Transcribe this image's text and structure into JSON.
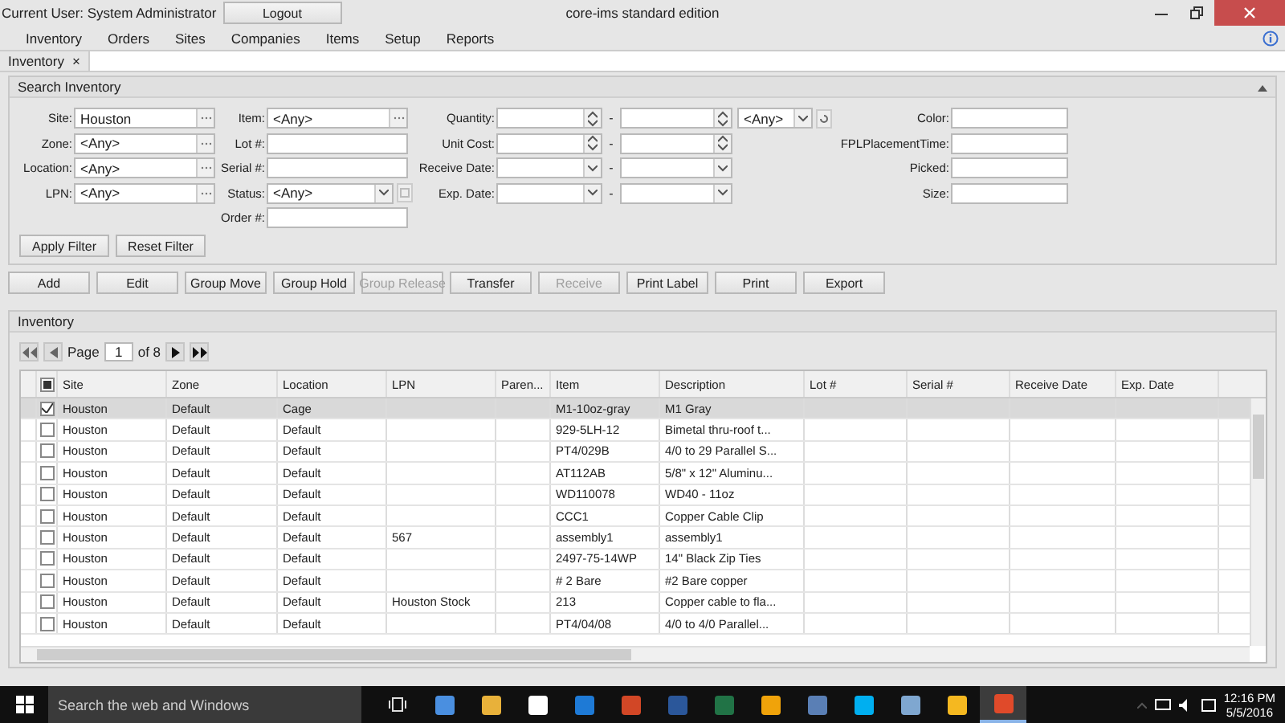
{
  "title_bar": {
    "current_user": "Current User: System Administrator",
    "logout": "Logout",
    "title": "core-ims standard edition"
  },
  "menu": [
    "Inventory",
    "Orders",
    "Sites",
    "Companies",
    "Items",
    "Setup",
    "Reports"
  ],
  "tabs": [
    {
      "label": "Inventory",
      "close": "×",
      "selected": true
    }
  ],
  "search": {
    "title": "Search Inventory",
    "columns": [
      [
        {
          "label": "Site:",
          "value": "Houston",
          "kind": "lookup"
        },
        {
          "label": "Zone:",
          "value": "<Any>",
          "kind": "lookup"
        },
        {
          "label": "Location:",
          "value": "<Any>",
          "kind": "lookup"
        },
        {
          "label": "LPN:",
          "value": "<Any>",
          "kind": "lookup"
        }
      ],
      [
        {
          "label": "Item:",
          "value": "<Any>",
          "kind": "lookup"
        },
        {
          "label": "Lot #:",
          "kind": "text"
        },
        {
          "label": "Serial #:",
          "kind": "text"
        },
        {
          "label": "Status:",
          "value": "<Any>",
          "kind": "status"
        },
        {
          "label": "Order #:",
          "kind": "text"
        }
      ],
      [
        {
          "label": "Quantity:",
          "kind": "number_range",
          "separator": "-",
          "unit": "<Any>"
        },
        {
          "label": "Unit Cost:",
          "kind": "number_range",
          "separator": "-"
        },
        {
          "label": "Receive Date:",
          "kind": "date_range",
          "separator": "-"
        },
        {
          "label": "Exp. Date:",
          "kind": "date_range",
          "separator": "-"
        }
      ],
      [
        {
          "label": "Color:",
          "kind": "text"
        },
        {
          "label": "FPLPlacementTime:",
          "kind": "text"
        },
        {
          "label": "Picked:",
          "kind": "text"
        },
        {
          "label": "Size:",
          "kind": "text"
        }
      ]
    ],
    "buttons": [
      "Apply Filter",
      "Reset Filter"
    ]
  },
  "actions": [
    {
      "label": "Add",
      "disabled": false
    },
    {
      "label": "Edit",
      "disabled": false
    },
    {
      "label": "Group Move",
      "disabled": false
    },
    {
      "label": "Group Hold",
      "disabled": false
    },
    {
      "label": "Group Release",
      "disabled": true
    },
    {
      "label": "Transfer",
      "disabled": false
    },
    {
      "label": "Receive",
      "disabled": true
    },
    {
      "label": "Print Label",
      "disabled": false
    },
    {
      "label": "Print",
      "disabled": false
    },
    {
      "label": "Export",
      "disabled": false
    }
  ],
  "grid": {
    "title": "Inventory",
    "pager": {
      "page_label": "Page",
      "page": "1",
      "of": "of 8"
    },
    "select_all": {
      "indeterminate": true
    },
    "columns": [
      "Site",
      "Zone",
      "Location",
      "LPN",
      "Paren...",
      "Item",
      "Description",
      "Lot #",
      "Serial #",
      "Receive Date",
      "Exp. Date"
    ],
    "rows": [
      {
        "checked": true,
        "selected": true,
        "cells": [
          "Houston",
          "Default",
          "Cage",
          "",
          "",
          "M1-10oz-gray",
          "M1 Gray",
          "",
          "",
          "",
          ""
        ]
      },
      {
        "checked": false,
        "selected": false,
        "cells": [
          "Houston",
          "Default",
          "Default",
          "",
          "",
          "929-5LH-12",
          "Bimetal thru-roof t...",
          "",
          "",
          "",
          ""
        ]
      },
      {
        "checked": false,
        "selected": false,
        "cells": [
          "Houston",
          "Default",
          "Default",
          "",
          "",
          "PT4/029B",
          "4/0 to 29 Parallel S...",
          "",
          "",
          "",
          ""
        ]
      },
      {
        "checked": false,
        "selected": false,
        "cells": [
          "Houston",
          "Default",
          "Default",
          "",
          "",
          "AT112AB",
          "5/8\" x 12\" Aluminu...",
          "",
          "",
          "",
          ""
        ]
      },
      {
        "checked": false,
        "selected": false,
        "cells": [
          "Houston",
          "Default",
          "Default",
          "",
          "",
          "WD110078",
          "WD40 - 11oz",
          "",
          "",
          "",
          ""
        ]
      },
      {
        "checked": false,
        "selected": false,
        "cells": [
          "Houston",
          "Default",
          "Default",
          "",
          "",
          "CCC1",
          "Copper Cable Clip",
          "",
          "",
          "",
          ""
        ]
      },
      {
        "checked": false,
        "selected": false,
        "cells": [
          "Houston",
          "Default",
          "Default",
          "567",
          "",
          "assembly1",
          "assembly1",
          "",
          "",
          "",
          ""
        ]
      },
      {
        "checked": false,
        "selected": false,
        "cells": [
          "Houston",
          "Default",
          "Default",
          "",
          "",
          "2497-75-14WP",
          "14\" Black Zip Ties",
          "",
          "",
          "",
          ""
        ]
      },
      {
        "checked": false,
        "selected": false,
        "cells": [
          "Houston",
          "Default",
          "Default",
          "",
          "",
          "# 2 Bare",
          "#2 Bare copper",
          "",
          "",
          "",
          ""
        ]
      },
      {
        "checked": false,
        "selected": false,
        "cells": [
          "Houston",
          "Default",
          "Default",
          "Houston Stock",
          "",
          "213",
          "Copper cable to fla...",
          "",
          "",
          "",
          ""
        ]
      },
      {
        "checked": false,
        "selected": false,
        "cells": [
          "Houston",
          "Default",
          "Default",
          "",
          "",
          "PT4/04/08",
          "4/0 to 4/0 Parallel...",
          "",
          "",
          "",
          ""
        ]
      }
    ]
  },
  "taskbar": {
    "search_placeholder": "Search the web and Windows",
    "time": "12:16 PM",
    "date": "5/5/2016",
    "apps": [
      {
        "color": "#4a8fe0",
        "active": false
      },
      {
        "color": "#e8b13a",
        "active": false
      },
      {
        "color": "#ffffff",
        "active": false
      },
      {
        "color": "#1e7ad6",
        "active": false
      },
      {
        "color": "#d24726",
        "active": false
      },
      {
        "color": "#2b579a",
        "active": false
      },
      {
        "color": "#217346",
        "active": false
      },
      {
        "color": "#f0a30a",
        "active": false
      },
      {
        "color": "#5a7fb5",
        "active": false
      },
      {
        "color": "#00aff0",
        "active": false
      },
      {
        "color": "#7fa7d0",
        "active": false
      },
      {
        "color": "#f5b820",
        "active": false
      },
      {
        "color": "#e04a2a",
        "active": true
      }
    ]
  }
}
